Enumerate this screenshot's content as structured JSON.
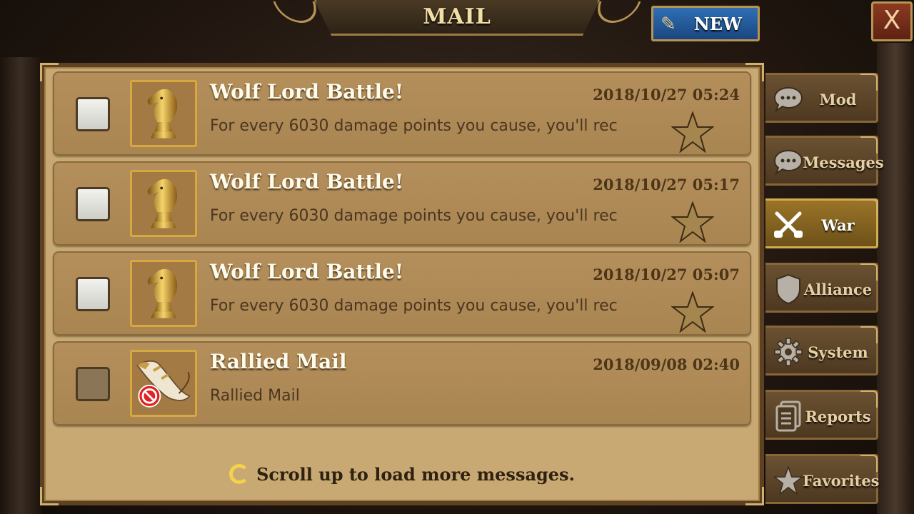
{
  "header": {
    "title": "MAIL",
    "new_button_label": "NEW",
    "close_label": "X"
  },
  "mails": [
    {
      "title": "Wolf Lord Battle!",
      "date": "2018/10/27 05:24",
      "preview": "For every 6030 damage points you cause, you'll rec",
      "icon": "knight-chess-icon",
      "checked": false
    },
    {
      "title": "Wolf Lord Battle!",
      "date": "2018/10/27 05:17",
      "preview": "For every 6030 damage points you cause, you'll rec",
      "icon": "knight-chess-icon",
      "checked": false
    },
    {
      "title": "Wolf Lord Battle!",
      "date": "2018/10/27 05:07",
      "preview": "For every 6030 damage points you cause, you'll rec",
      "icon": "knight-chess-icon",
      "checked": false
    },
    {
      "title": "Rallied Mail",
      "date": "2018/09/08 02:40",
      "preview": "Rallied Mail",
      "icon": "war-horn-icon",
      "checked": false
    }
  ],
  "load_more_text": "Scroll up to load more messages.",
  "tabs": [
    {
      "label": "Mod",
      "icon": "chat-bubble-icon",
      "active": false
    },
    {
      "label": "Messages",
      "icon": "chat-bubble-icon",
      "active": false
    },
    {
      "label": "War",
      "icon": "crossed-pistols-icon",
      "active": true
    },
    {
      "label": "Alliance",
      "icon": "shield-icon",
      "active": false
    },
    {
      "label": "System",
      "icon": "gear-icon",
      "active": false
    },
    {
      "label": "Reports",
      "icon": "document-icon",
      "active": false
    },
    {
      "label": "Favorites",
      "icon": "star-icon",
      "active": false
    }
  ],
  "colors": {
    "panel": "#c9a973",
    "row": "#b48f5c",
    "title_text": "#fffbea",
    "active_tab": "#9a7428",
    "new_button": "#2f6fb4"
  }
}
